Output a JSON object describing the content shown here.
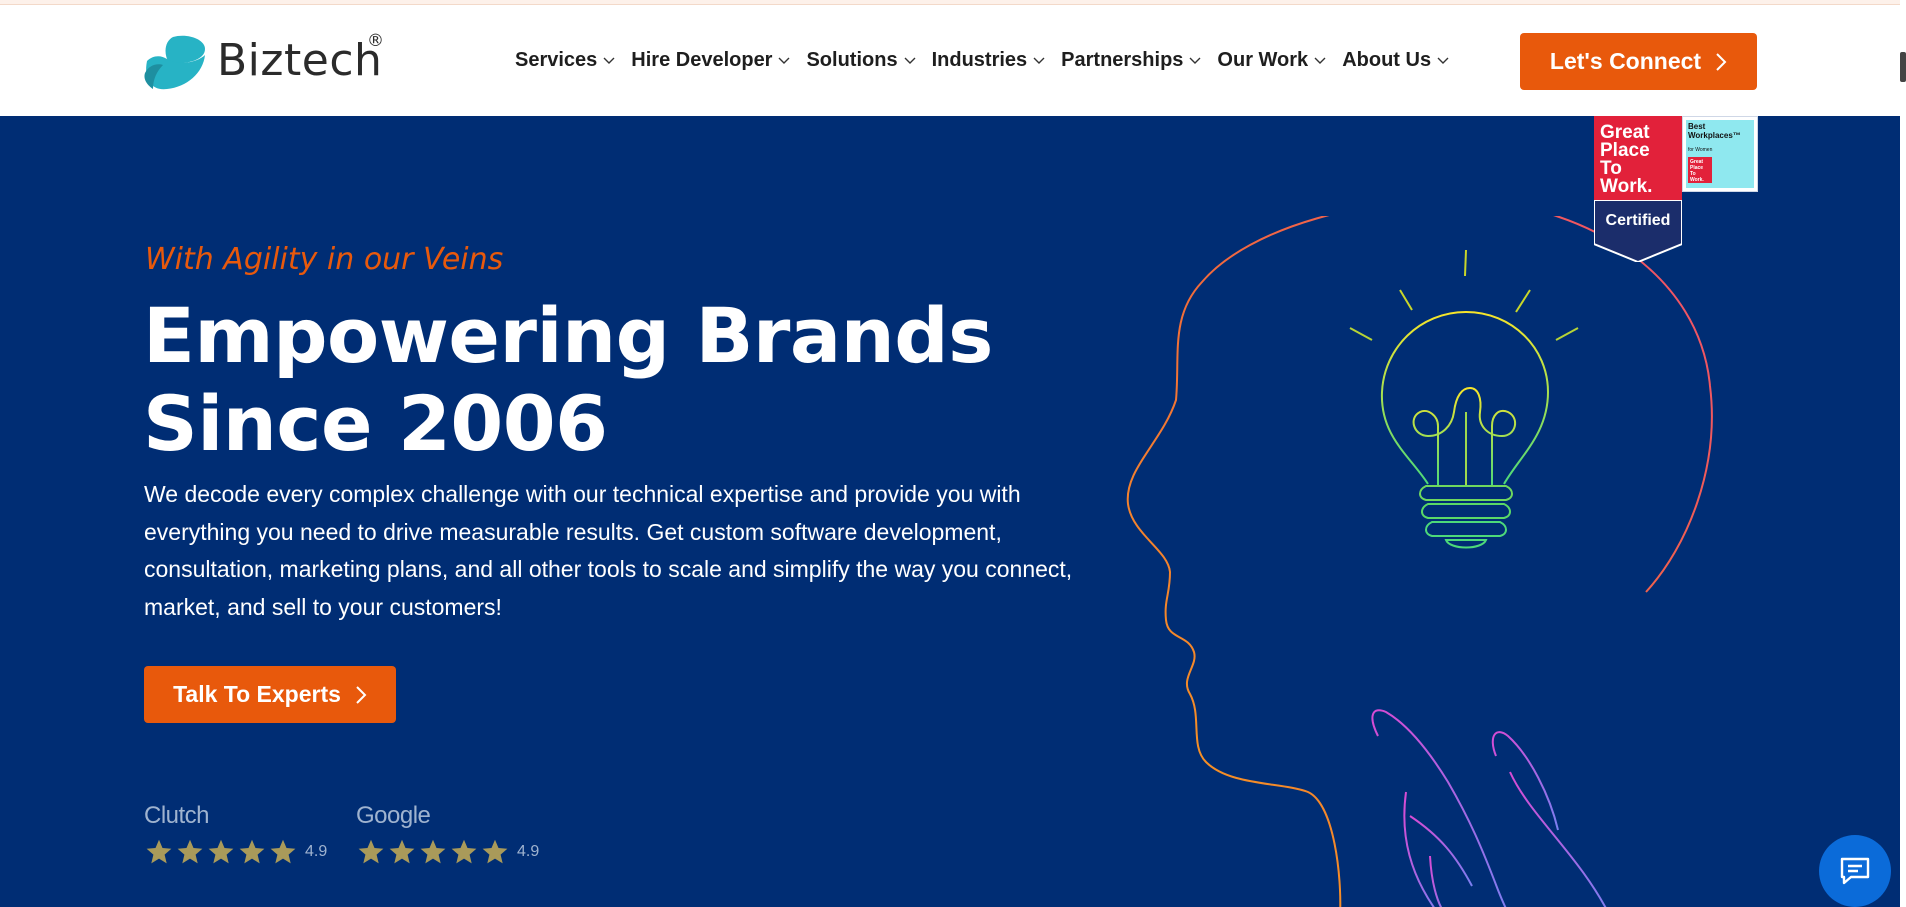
{
  "logo": {
    "text": "Biztech",
    "registered": "®"
  },
  "nav": {
    "items": [
      {
        "label": "Services"
      },
      {
        "label": "Hire Developer"
      },
      {
        "label": "Solutions"
      },
      {
        "label": "Industries"
      },
      {
        "label": "Partnerships"
      },
      {
        "label": "Our Work"
      },
      {
        "label": "About Us"
      }
    ],
    "cta_label": "Let's Connect"
  },
  "hero": {
    "tagline": "With Agility in our Veins",
    "headline_line1": "Empowering Brands",
    "headline_line2": "Since 2006",
    "description": "We decode every complex challenge with our technical expertise and provide you with everything you need to drive measurable results. Get custom software development, consultation, marketing plans, and all other tools to scale and simplify the way you connect, market, and sell to your customers!",
    "cta_label": "Talk To Experts"
  },
  "ratings": [
    {
      "brand": "Clutch",
      "score": "4.9",
      "stars": 5
    },
    {
      "brand": "Google",
      "score": "4.9",
      "stars": 5
    }
  ],
  "badges": {
    "gptw": {
      "line1": "Great",
      "line2": "Place",
      "line3": "To",
      "line4": "Work.",
      "certified": "Certified"
    },
    "best_workplaces": {
      "title": "Best Workplaces™",
      "subtitle": "for Women",
      "mini": "Great Place To Work."
    }
  },
  "colors": {
    "accent": "#e8590c",
    "hero_bg": "#002d74",
    "star": "#a99a5a",
    "chat": "#0b6bd9"
  },
  "icons": {
    "chat": "chat-bubble-icon",
    "chevron": "chevron-right-icon",
    "dropdown": "chevron-down-icon"
  }
}
